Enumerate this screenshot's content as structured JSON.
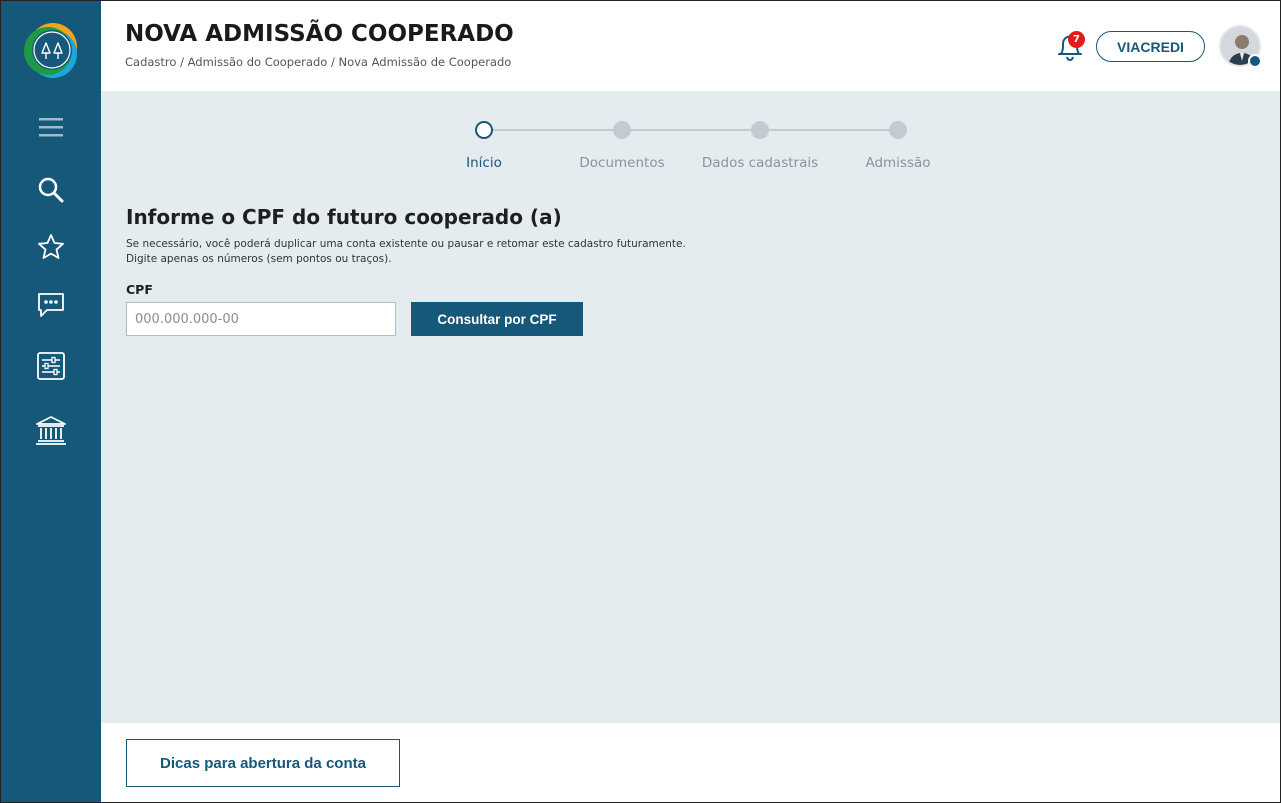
{
  "header": {
    "title": "NOVA ADMISSÃO COOPERADO",
    "breadcrumb": "Cadastro / Admissão do Cooperado / Nova Admissão de Cooperado",
    "notification_count": "7",
    "org_label": "VIACREDI"
  },
  "sidebar": {
    "items": [
      {
        "icon": "menu-icon"
      },
      {
        "icon": "search-icon"
      },
      {
        "icon": "star-icon"
      },
      {
        "icon": "chat-icon"
      },
      {
        "icon": "settings-sliders-icon"
      },
      {
        "icon": "bank-icon"
      }
    ]
  },
  "stepper": {
    "steps": [
      {
        "label": "Início",
        "state": "active"
      },
      {
        "label": "Documentos",
        "state": "pending"
      },
      {
        "label": "Dados cadastrais",
        "state": "pending"
      },
      {
        "label": "Admissão",
        "state": "pending"
      }
    ]
  },
  "form": {
    "title": "Informe o CPF do futuro cooperado (a)",
    "help_line1": "Se necessário, você poderá duplicar uma conta existente ou pausar e retomar este cadastro futuramente.",
    "help_line2": "Digite apenas os números (sem pontos ou traços).",
    "cpf_label": "CPF",
    "cpf_placeholder": "000.000.000-00",
    "cpf_value": "",
    "submit_label": "Consultar por CPF"
  },
  "footer": {
    "tips_label": "Dicas para abertura da conta"
  },
  "colors": {
    "primary": "#16587a",
    "background": "#e5ecf0",
    "badge": "#e11c1c",
    "step_inactive": "#c3cbd1"
  }
}
